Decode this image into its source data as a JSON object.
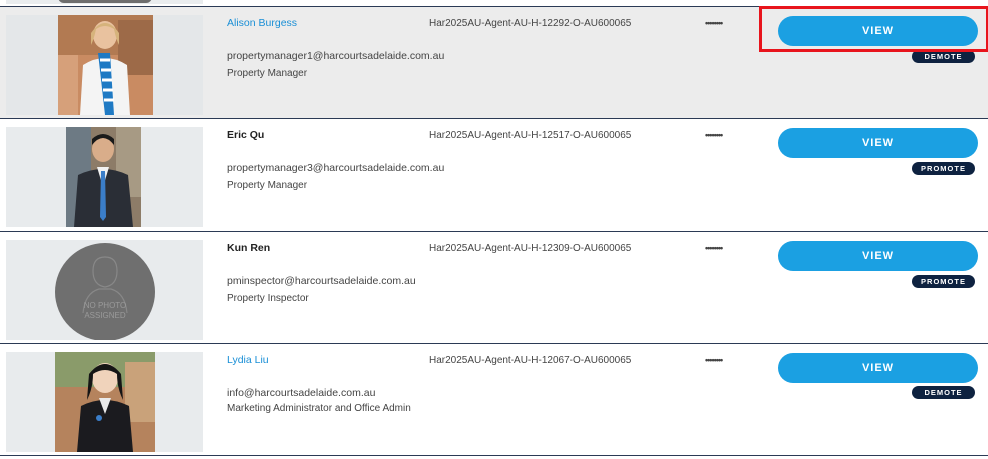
{
  "agents": [
    {
      "name": "Alison Burgess",
      "email": "propertymanager1@harcourtsadelaide.com.au",
      "role": "Property Manager",
      "code": "Har2025AU-Agent-AU-H-12292-O-AU600065",
      "password_mask": "••••••••",
      "view_label": "VIEW",
      "tag_label": "DEMOTE"
    },
    {
      "name": "Eric Qu",
      "email": "propertymanager3@harcourtsadelaide.com.au",
      "role": "Property Manager",
      "code": "Har2025AU-Agent-AU-H-12517-O-AU600065",
      "password_mask": "••••••••",
      "view_label": "VIEW",
      "tag_label": "PROMOTE"
    },
    {
      "name": "Kun Ren",
      "email": "pminspector@harcourtsadelaide.com.au",
      "role": "Property Inspector",
      "code": "Har2025AU-Agent-AU-H-12309-O-AU600065",
      "password_mask": "••••••••",
      "view_label": "VIEW",
      "tag_label": "PROMOTE",
      "no_photo_line1": "NO PHOTO",
      "no_photo_line2": "ASSIGNED"
    },
    {
      "name": "Lydia Liu",
      "email": "info@harcourtsadelaide.com.au",
      "role": "Marketing Administrator and Office Admin",
      "code": "Har2025AU-Agent-AU-H-12067-O-AU600065",
      "password_mask": "••••••••",
      "view_label": "VIEW",
      "tag_label": "DEMOTE"
    }
  ],
  "colors": {
    "view_button": "#1ba0e2",
    "tag_button": "#0e2240",
    "link_name": "#1a8fd6",
    "highlight_box": "#e8141c",
    "row_divider": "#2b3a55"
  }
}
